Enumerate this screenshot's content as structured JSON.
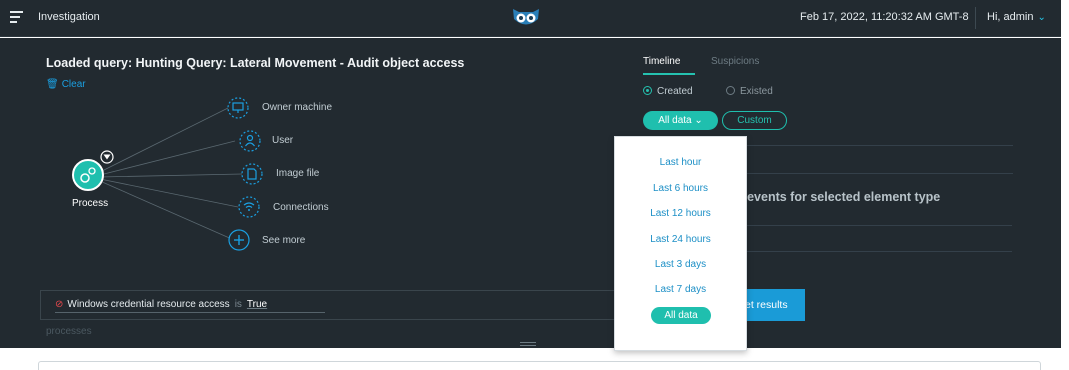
{
  "topbar": {
    "title": "Investigation",
    "datetime": "Feb 17, 2022, 11:20:32 AM GMT-8",
    "user_greeting": "Hi, admin",
    "menu_icon": "hamburger-icon",
    "logo_icon": "owl-logo",
    "user_chevron_icon": "chevron-down-icon"
  },
  "query": {
    "title": "Loaded query: Hunting Query: Lateral Movement - Audit object access",
    "clear_label": "Clear"
  },
  "graph": {
    "root": {
      "label": "Process",
      "icon": "gears-icon"
    },
    "nodes": [
      {
        "label": "Owner machine",
        "icon": "monitor-icon"
      },
      {
        "label": "User",
        "icon": "user-icon"
      },
      {
        "label": "Image file",
        "icon": "file-icon"
      },
      {
        "label": "Connections",
        "icon": "wifi-icon"
      },
      {
        "label": "See more",
        "icon": "plus-icon"
      }
    ]
  },
  "filter": {
    "field": "Windows credential resource access",
    "operator": "is",
    "value": "True"
  },
  "processes_label": "processes",
  "get_results_label": "et results",
  "timeline": {
    "tabs": [
      "Timeline",
      "Suspicions"
    ],
    "active_tab": "Timeline",
    "radios": [
      {
        "label": "Created",
        "checked": true
      },
      {
        "label": "Existed",
        "checked": false
      }
    ],
    "alldata_label": "All data",
    "custom_label": "Custom",
    "empty_message": "o events for selected element type"
  },
  "dropdown": {
    "options": [
      "Last hour",
      "Last 6 hours",
      "Last 12 hours",
      "Last 24 hours",
      "Last 3 days",
      "Last 7 days",
      "All data"
    ],
    "selected": "All data"
  },
  "colors": {
    "background": "#222a30",
    "accent_teal": "#1fbfae",
    "accent_blue": "#1a9bd7",
    "link_blue": "#1c8fc6"
  }
}
